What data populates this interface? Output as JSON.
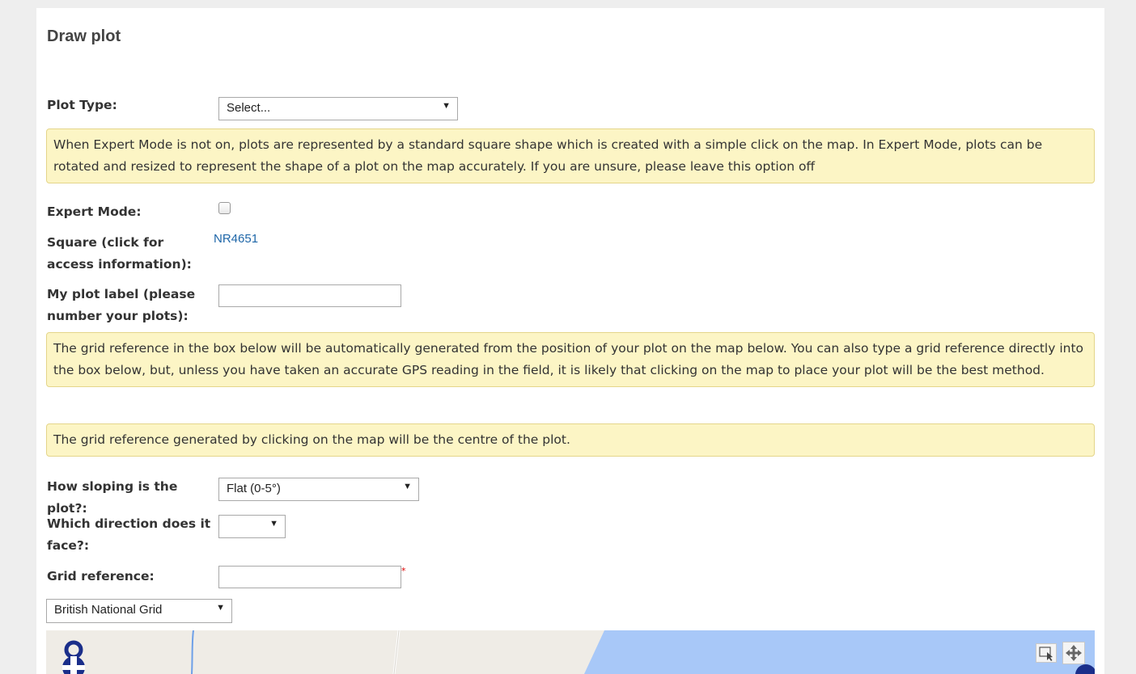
{
  "form": {
    "title": "Draw plot",
    "plot_type": {
      "label": "Plot Type:",
      "selected": "Select..."
    },
    "expert_info": "When Expert Mode is not on, plots are represented by a standard square shape which is created with a simple click on the map. In Expert Mode, plots can be rotated and resized to represent the shape of a plot on the map accurately. If you are unsure, please leave this option off",
    "expert_mode": {
      "label": "Expert Mode:"
    },
    "square": {
      "label": "Square (click for access information):",
      "value": "NR4651"
    },
    "plot_label": {
      "label": "My plot label (please number your plots):",
      "value": ""
    },
    "grid_info": "The grid reference in the box below will be automatically generated from the position of your plot on the map below. You can also type a grid reference directly into the box below, but, unless you have taken an accurate GPS reading in the field, it is likely that clicking on the map to place your plot will be the best method.",
    "centre_info": "The grid reference generated by clicking on the map will be the centre of the plot.",
    "slope": {
      "label": "How sloping is the plot?:",
      "selected": "Flat (0-5°)"
    },
    "direction": {
      "label": "Which direction does it face?:",
      "selected": ""
    },
    "grid_ref": {
      "label": "Grid reference:",
      "value": "",
      "required_mark": "*"
    },
    "grid_system": {
      "selected": "British National Grid"
    }
  },
  "colors": {
    "info_bg": "#fcf5c5",
    "link": "#1e66a8",
    "water": "#a8c8f8"
  },
  "map": {
    "controls": [
      "select-box-icon",
      "pan-icon"
    ],
    "logo_icon": "map-logo-icon"
  }
}
